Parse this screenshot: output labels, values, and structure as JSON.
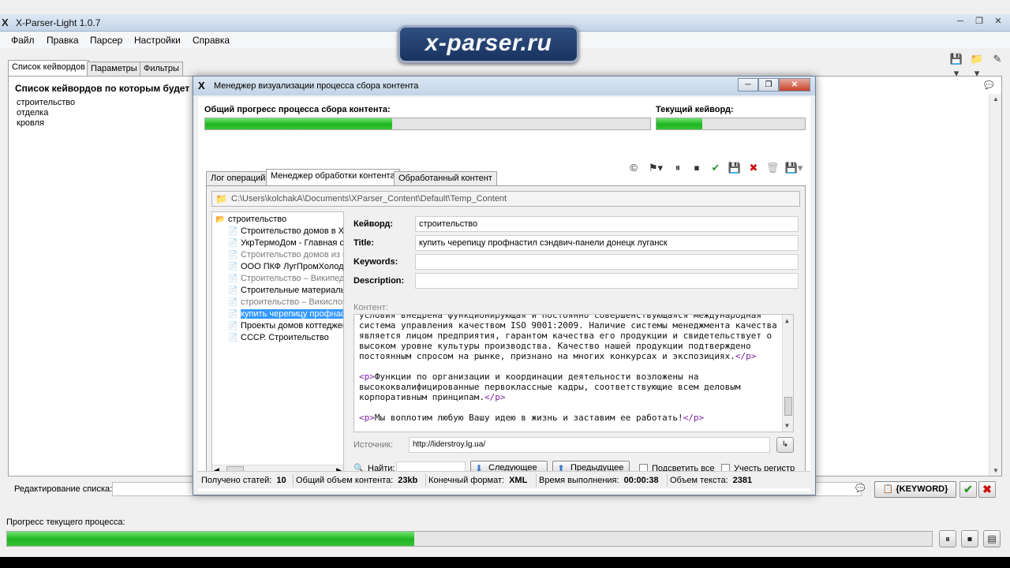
{
  "window": {
    "title": "X-Parser-Light 1.0.7",
    "logo_text": "x-parser.ru"
  },
  "menu": [
    "Файл",
    "Правка",
    "Парсер",
    "Настройки",
    "Справка"
  ],
  "main_tabs": [
    "Список кейвордов",
    "Параметры",
    "Фильтры"
  ],
  "keywords_panel": {
    "title": "Список кейвордов по которым будет со",
    "items": [
      "строительство",
      "отделка",
      "кровля"
    ]
  },
  "edit_row": {
    "label": "Редактирование списка:",
    "keyword_button": "{KEYWORD}"
  },
  "bottom": {
    "progress_label": "Прогресс текущего процесса:",
    "progress_fraction": 0.44
  },
  "dialog": {
    "title": "Менеджер визуализации процесса сбора контента",
    "overall_label": "Общий прогресс процесса сбора контента:",
    "overall_fraction": 0.42,
    "current_label": "Текущий кейворд:",
    "current_fraction": 0.31,
    "tabs": [
      "Лог операций",
      "Менеджер обработки контента",
      "Обработанный контент"
    ],
    "path": "C:\\Users\\kolchakA\\Documents\\XParser_Content\\Default\\Temp_Content",
    "tree_root": "строительство",
    "tree_items": [
      {
        "label": "Строительство домов в Ха",
        "dim": false,
        "selected": false
      },
      {
        "label": "УкрТермоДом - Главная с",
        "dim": false,
        "selected": false
      },
      {
        "label": "Строительство домов из га",
        "dim": true,
        "selected": false
      },
      {
        "label": "ООО ПКФ ЛугПромХолод.",
        "dim": false,
        "selected": false
      },
      {
        "label": "Строительство – Википеди",
        "dim": true,
        "selected": false
      },
      {
        "label": "Строительные материалы",
        "dim": false,
        "selected": false
      },
      {
        "label": "строительство – Викислов",
        "dim": true,
        "selected": false
      },
      {
        "label": "купить черепицу профнаст",
        "dim": false,
        "selected": true
      },
      {
        "label": "Проекты домов коттеджей",
        "dim": false,
        "selected": false
      },
      {
        "label": "СССР. Строительство",
        "dim": false,
        "selected": false
      }
    ],
    "fields": {
      "keyword_label": "Кейворд:",
      "keyword_value": "строительство",
      "title_label": "Title:",
      "title_value": "купить черепицу профнастил сэндвич-панели донецк луганск",
      "keywords_label": "Keywords:",
      "keywords_value": "",
      "description_label": "Description:",
      "description_value": ""
    },
    "content_label": "Контент:",
    "content_paragraphs": [
      {
        "open": "",
        "text": "условия внедрена функционирующая и постоянно совершенствующаяся международная система управления качеством ISO 9001:2009. Наличие системы менеджмента качества является лицом предприятия, гарантом качества его продукции и свидетельствует о высоком уровне культуры производства. Качество нашей продукции подтверждено постоянным спросом на рынке, признано на многих конкурсах и экспозициях.",
        "close": "</p>"
      },
      {
        "open": "<p>",
        "text": "Функции по организации и координации деятельности возложены на высококвалифицированные первоклассные кадры, соответствующие всем деловым корпоративным принципам.",
        "close": "</p>"
      },
      {
        "open": "<p>",
        "text": "Мы воплотим любую Вашу идею в жизнь и заставим ее работать!",
        "close": "</p>"
      }
    ],
    "source_label": "Источник:",
    "source_value": "http://liderstroy.lg.ua/",
    "find": {
      "label": "Найти:",
      "next": "Следующее",
      "prev": "Предыдущее",
      "highlight_all": "Подсветить все",
      "match_case": "Учесть регистр"
    },
    "status": {
      "articles_label": "Получено статей:",
      "articles_value": "10",
      "volume_label": "Общий объем контента:",
      "volume_value": "23kb",
      "format_label": "Конечный формат:",
      "format_value": "XML",
      "time_label": "Время выполнения:",
      "time_value": "00:00:38",
      "text_label": "Объем текста:",
      "text_value": "2381"
    }
  },
  "colors": {
    "progress_green": "#1fb51f",
    "selection_blue": "#3399ff",
    "tag_purple": "#7b1fa2"
  }
}
